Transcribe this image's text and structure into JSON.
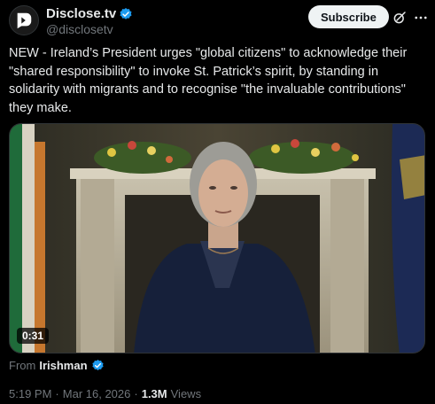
{
  "author": {
    "display_name": "Disclose.tv",
    "handle": "@disclosetv",
    "verified": true,
    "avatar_icon": "disclose-logo-icon"
  },
  "actions": {
    "subscribe_label": "Subscribe",
    "grok_icon": "grok-icon",
    "more_icon": "more-icon"
  },
  "tweet": {
    "text": "NEW - Ireland’s President urges \"global citizens\" to acknowledge their \"shared responsibility\" to invoke St. Patrick’s spirit, by standing in solidarity with migrants and to recognise \"the invaluable contributions\" they make."
  },
  "media": {
    "type": "video",
    "duration": "0:31"
  },
  "attribution": {
    "from_label": "From",
    "from_user": "Irishman",
    "verified": true
  },
  "meta": {
    "time": "5:19 PM",
    "separator": "·",
    "date": "Mar 16, 2026",
    "views_count": "1.3M",
    "views_label": "Views"
  },
  "colors": {
    "background": "#000000",
    "text": "#e7e9ea",
    "muted": "#71767b",
    "verified_blue": "#1d9bf0"
  }
}
